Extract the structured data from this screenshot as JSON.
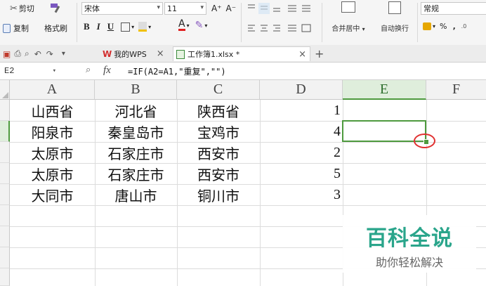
{
  "ribbon": {
    "cut_label": "剪切",
    "copy_label": "复制",
    "format_painter_label": "格式刷",
    "font_name": "宋体",
    "font_size": "11",
    "font_grow": "A⁺",
    "font_shrink": "A⁻",
    "bold": "B",
    "italic": "I",
    "underline": "U",
    "font_color_glyph": "A",
    "merge_center_label": "合并居中",
    "auto_wrap_label": "自动换行",
    "number_format": "常规",
    "percent": "%",
    "comma": "‚",
    "accent_green": "#4e9a3e"
  },
  "tabs": {
    "wps_label": "我的WPS",
    "workbook_label": "工作簿1.xlsx *",
    "close_glyph": "×",
    "new_tab_glyph": "+"
  },
  "formula_bar": {
    "cell_ref": "E2",
    "fx": "fx",
    "formula": "=IF(A2=A1,\"重复\",\"\")"
  },
  "columns": [
    "A",
    "B",
    "C",
    "D",
    "E",
    "F"
  ],
  "rows": [
    [
      "山西省",
      "河北省",
      "陕西省",
      "1"
    ],
    [
      "阳泉市",
      "秦皇岛市",
      "宝鸡市",
      "4"
    ],
    [
      "太原市",
      "石家庄市",
      "西安市",
      "2"
    ],
    [
      "太原市",
      "石家庄市",
      "西安市",
      "5"
    ],
    [
      "大同市",
      "唐山市",
      "铜川市",
      "3"
    ]
  ],
  "watermark": {
    "title": "百科全说",
    "subtitle": "助你轻松解决"
  }
}
